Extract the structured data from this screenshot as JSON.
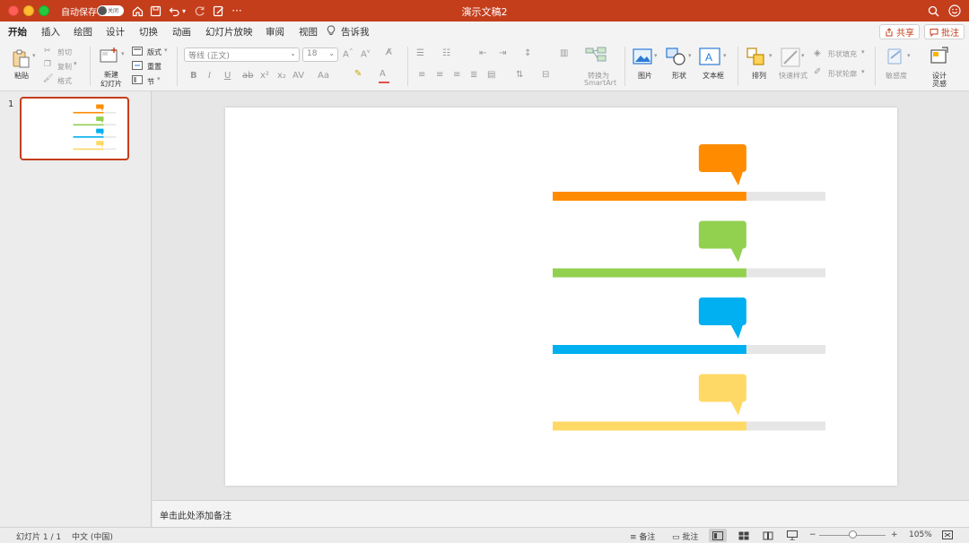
{
  "window": {
    "title": "演示文稿2",
    "autosave_label": "自动保存",
    "autosave_state": "关闭"
  },
  "tabs": [
    {
      "label": "开始",
      "active": true
    },
    {
      "label": "插入"
    },
    {
      "label": "绘图"
    },
    {
      "label": "设计"
    },
    {
      "label": "切换"
    },
    {
      "label": "动画"
    },
    {
      "label": "幻灯片放映"
    },
    {
      "label": "审阅"
    },
    {
      "label": "视图"
    },
    {
      "label": "告诉我"
    }
  ],
  "top_buttons": {
    "share": "共享",
    "comments": "批注"
  },
  "ribbon": {
    "paste": "粘贴",
    "cut": "剪切",
    "copy": "复制",
    "format": "格式",
    "new_slide": "新建",
    "new_slide2": "幻灯片",
    "layout": "版式",
    "reset": "重置",
    "section": "节",
    "font_name": "等线 (正文)",
    "font_size": "18",
    "convert_smartart1": "转换为",
    "convert_smartart2": "SmartArt",
    "picture": "图片",
    "shape": "形状",
    "textbox": "文本框",
    "arrange": "排列",
    "quick_styles": "快速样式",
    "shape_fill": "形状填充",
    "shape_outline": "形状轮廓",
    "sensitivity": "敏感度",
    "designer1": "设计",
    "designer2": "灵感"
  },
  "thumbnail": {
    "number": "1"
  },
  "slide": {
    "bars": [
      {
        "color": "#ff8c00",
        "value": 0.71
      },
      {
        "color": "#92d050",
        "value": 0.71
      },
      {
        "color": "#00b0f0",
        "value": 0.71
      },
      {
        "color": "#ffd966",
        "value": 0.71
      }
    ],
    "track_color": "#e6e6e6"
  },
  "notes": {
    "placeholder": "单击此处添加备注"
  },
  "status": {
    "slide_counter": "幻灯片 1 / 1",
    "language": "中文 (中国)",
    "notes": "备注",
    "comments": "批注",
    "zoom": "105%"
  }
}
